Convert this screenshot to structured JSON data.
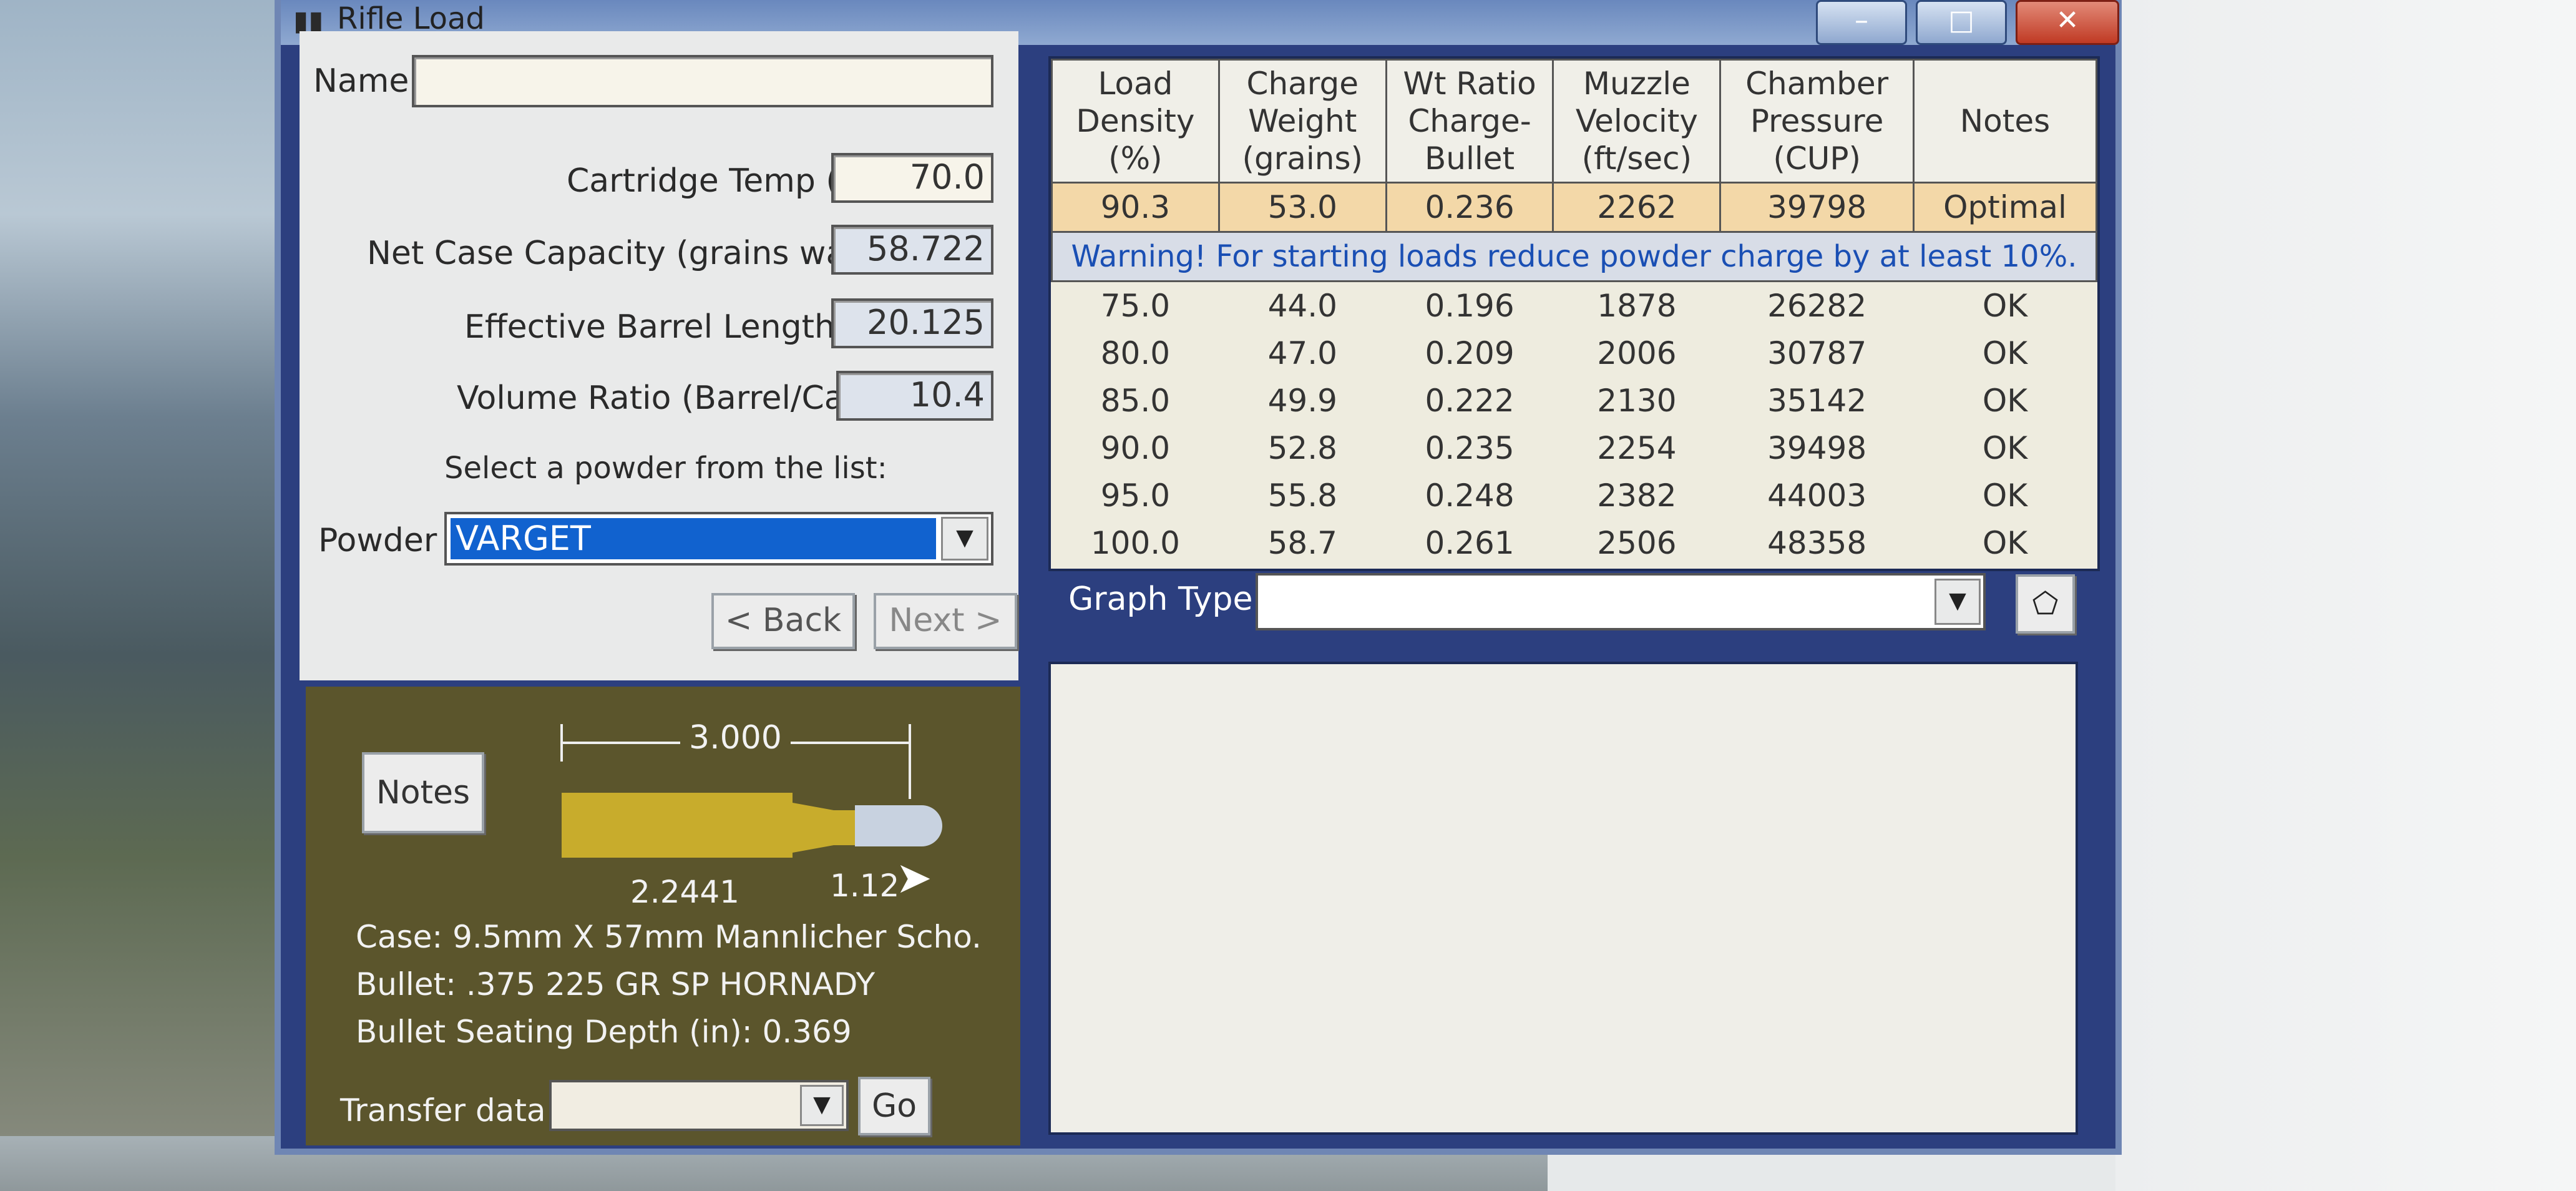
{
  "window": {
    "title": "Rifle Load",
    "title_icon": "rifle-icon",
    "controls": {
      "minimize": "–",
      "maximize": "□",
      "close": "✕"
    }
  },
  "inputs": {
    "name_label": "Name",
    "name_value": "",
    "cartridge_temp_label": "Cartridge Temp (˚F)",
    "cartridge_temp_value": "70.0",
    "net_case_label": "Net Case Capacity (grains water)",
    "net_case_value": "58.722",
    "barrel_length_label": "Effective Barrel Length (in)",
    "barrel_length_value": "20.125",
    "volume_ratio_label": "Volume Ratio (Barrel/Case)",
    "volume_ratio_value": "10.4",
    "select_powder_hint": "Select a powder from the list:",
    "powder_label": "Powder",
    "powder_value": "VARGET",
    "back_label": "< Back",
    "next_label": "Next >"
  },
  "cartridge": {
    "notes_label": "Notes",
    "overall_length": "3.000",
    "case_length": "2.2441",
    "bullet_length": "1.12",
    "case": "Case: 9.5mm X 57mm Mannlicher Scho.",
    "bullet": "Bullet: .375 225 GR SP HORNADY",
    "seating_depth": "Bullet Seating Depth (in): 0.369",
    "transfer_label": "Transfer data to",
    "transfer_value": "",
    "go_label": "Go"
  },
  "table": {
    "headers": [
      [
        "Load",
        "Density",
        "(%)"
      ],
      [
        "Charge",
        "Weight",
        "(grains)"
      ],
      [
        "Wt Ratio",
        "Charge-",
        "Bullet"
      ],
      [
        "Muzzle",
        "Velocity",
        "(ft/sec)"
      ],
      [
        "Chamber",
        "Pressure",
        "(CUP)"
      ],
      [
        "Notes"
      ]
    ],
    "optimal": [
      "90.3",
      "53.0",
      "0.236",
      "2262",
      "39798",
      "Optimal"
    ],
    "warning": "Warning! For starting loads reduce powder charge by at least 10%.",
    "rows": [
      [
        "75.0",
        "44.0",
        "0.196",
        "1878",
        "26282",
        "OK"
      ],
      [
        "80.0",
        "47.0",
        "0.209",
        "2006",
        "30787",
        "OK"
      ],
      [
        "85.0",
        "49.9",
        "0.222",
        "2130",
        "35142",
        "OK"
      ],
      [
        "90.0",
        "52.8",
        "0.235",
        "2254",
        "39498",
        "OK"
      ],
      [
        "95.0",
        "55.8",
        "0.248",
        "2382",
        "44003",
        "OK"
      ],
      [
        "100.0",
        "58.7",
        "0.261",
        "2506",
        "48358",
        "OK"
      ]
    ]
  },
  "graph": {
    "label": "Graph Type",
    "value": "",
    "button_icon": "tag-icon"
  }
}
